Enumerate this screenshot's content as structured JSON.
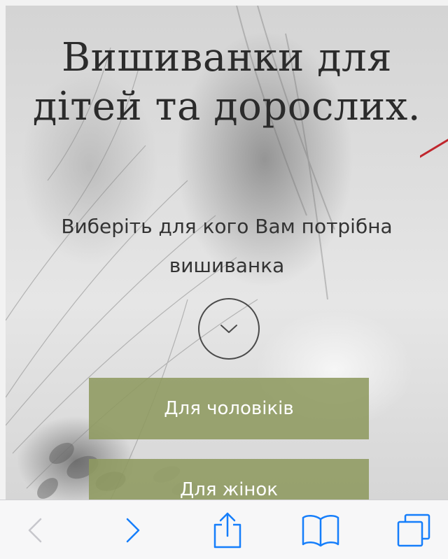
{
  "hero": {
    "title_line1": "Вишиванки для",
    "title_line2": "дітей та дорослих.",
    "subtitle": "Виберіть для кого Вам потрібна вишиванка",
    "scroll_icon": "chevron-down-icon"
  },
  "categories": [
    {
      "label": "Для чоловіків"
    },
    {
      "label": "Для жінок"
    }
  ],
  "colors": {
    "button_bg": "#8e9a60",
    "button_text": "#ffffff",
    "title_text": "#2b2b2b",
    "toolbar_accent": "#157efb",
    "toolbar_disabled": "#c7c7cc"
  },
  "toolbar": {
    "items": [
      {
        "icon": "back-arrow-icon",
        "enabled": false
      },
      {
        "icon": "forward-arrow-icon",
        "enabled": true
      },
      {
        "icon": "share-icon",
        "enabled": true
      },
      {
        "icon": "bookmarks-icon",
        "enabled": true
      },
      {
        "icon": "tabs-icon",
        "enabled": true
      }
    ]
  }
}
